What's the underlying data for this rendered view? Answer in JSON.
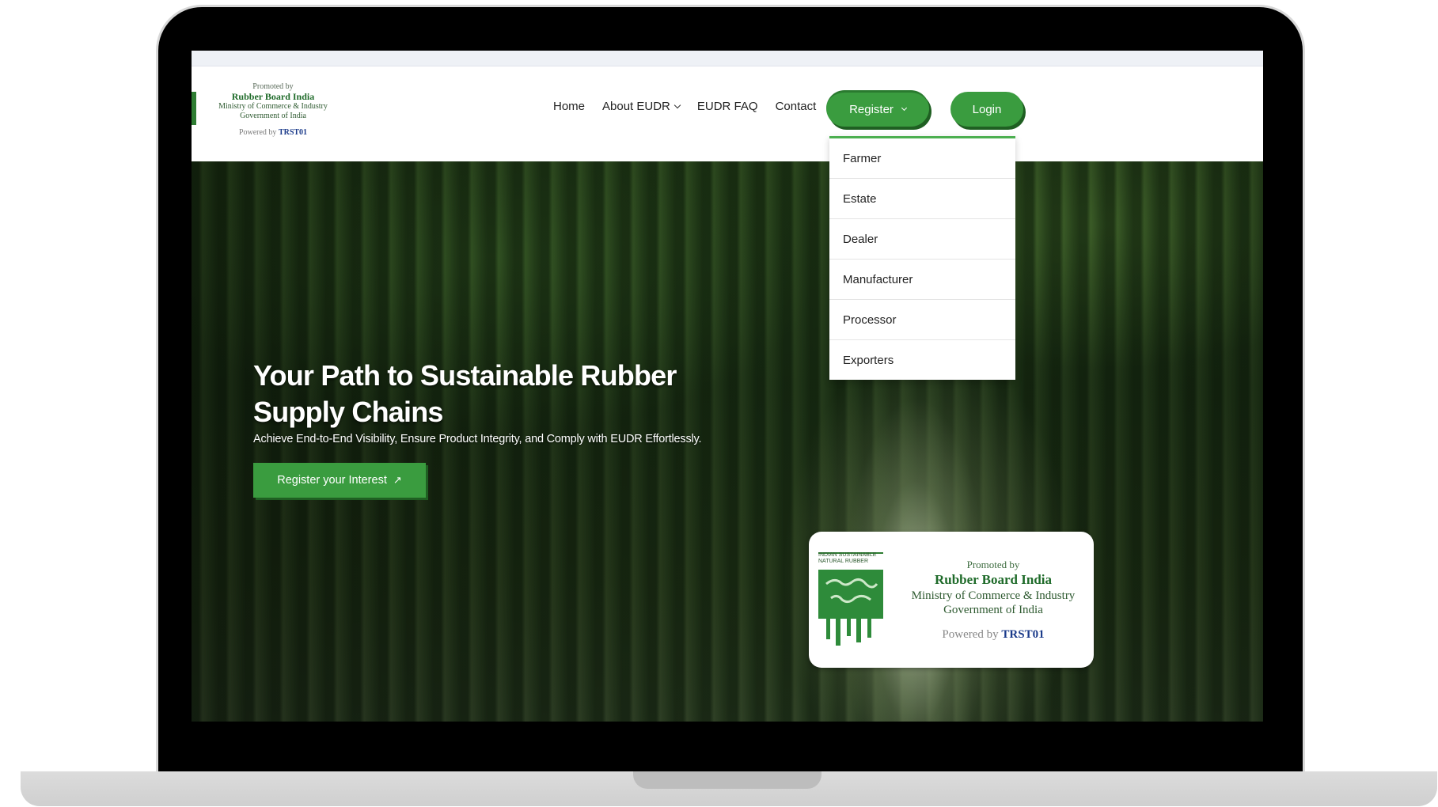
{
  "header": {
    "logo": {
      "promoted": "Promoted by",
      "title": "Rubber Board India",
      "line1": "Ministry of Commerce & Industry",
      "line2": "Government of India",
      "powered_prefix": "Powered by",
      "powered_brand": "TRST01"
    },
    "nav": [
      {
        "label": "Home"
      },
      {
        "label": "About EUDR"
      },
      {
        "label": "EUDR FAQ"
      },
      {
        "label": "Contact"
      }
    ],
    "register_label": "Register",
    "login_label": "Login"
  },
  "register_menu": {
    "items": [
      "Farmer",
      "Estate",
      "Dealer",
      "Manufacturer",
      "Processor",
      "Exporters"
    ]
  },
  "hero": {
    "title": "Your Path to Sustainable Rubber Supply Chains",
    "subtitle": "Achieve End-to-End Visibility, Ensure Product Integrity, and Comply with EUDR Effortlessly.",
    "cta_label": "Register your Interest",
    "cta_icon": "arrow-up-right-icon"
  },
  "promo_card": {
    "badge": "INDIAN SUSTAINABLE NATURAL RUBBER",
    "promoted": "Promoted by",
    "title": "Rubber Board India",
    "line1": "Ministry of Commerce & Industry",
    "line2": "Government of India",
    "powered_prefix": "Powered by",
    "powered_brand": "TRST01"
  },
  "colors": {
    "primary_green": "#3a9c3f",
    "dark_green": "#1f5f22",
    "brand_blue": "#1a3a8a"
  }
}
